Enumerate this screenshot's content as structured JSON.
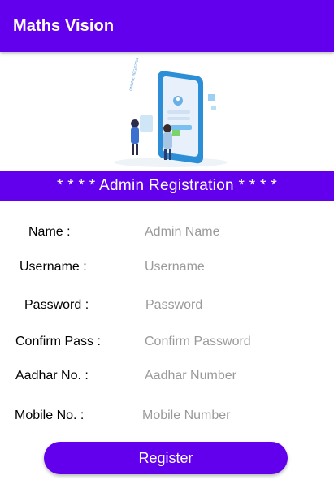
{
  "app_bar": {
    "title": "Maths Vision"
  },
  "illustration": {
    "caption": "ONLINE REGISTRATION"
  },
  "banner": {
    "text": "* * * * Admin Registration * * * *"
  },
  "form": {
    "fields": [
      {
        "label": "Name :",
        "placeholder": "Admin Name",
        "value": ""
      },
      {
        "label": "Username :",
        "placeholder": "Username",
        "value": ""
      },
      {
        "label": "Password :",
        "placeholder": "Password",
        "value": ""
      },
      {
        "label": "Confirm Pass :",
        "placeholder": "Confirm Password",
        "value": ""
      },
      {
        "label": "Aadhar No. :",
        "placeholder": "Aadhar Number",
        "value": ""
      },
      {
        "label": "Mobile No. :",
        "placeholder": "Mobile Number",
        "value": ""
      }
    ],
    "submit_label": "Register"
  },
  "colors": {
    "primary": "#6200ee",
    "placeholder": "#9a9a9a"
  }
}
